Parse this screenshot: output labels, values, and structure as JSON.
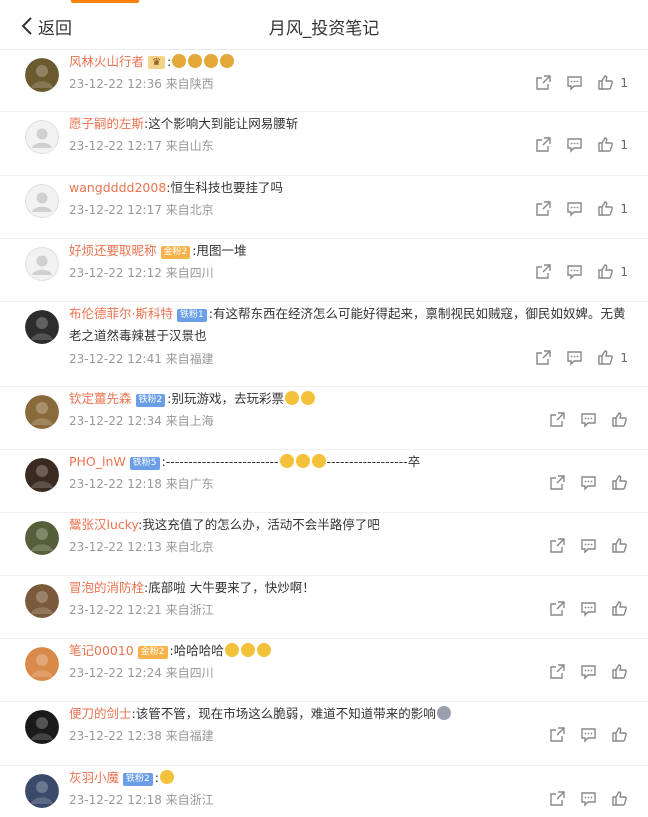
{
  "header": {
    "back_label": "返回",
    "title": "月风_投资笔记"
  },
  "comments": [
    {
      "user": "风林火山行者",
      "badge": "♛",
      "badge_type": "crown",
      "text": "",
      "emojis": [
        "#e2a83a",
        "#e2a83a",
        "#e2a83a",
        "#e2a83a"
      ],
      "meta": "23-12-22 12:36 来自陕西",
      "likes": "1",
      "avatar_color": "#6b5a30"
    },
    {
      "user": "愿子嗣的左斯",
      "badge": "",
      "badge_type": "",
      "text": "这个影响大到能让网易腰斩",
      "emojis": [],
      "meta": "23-12-22 12:17 来自山东",
      "likes": "1",
      "avatar_color": "#d8d8d8"
    },
    {
      "user": "wangdddd2008",
      "badge": "",
      "badge_type": "",
      "text": "恒生科技也要挂了吗",
      "emojis": [],
      "meta": "23-12-22 12:17 来自北京",
      "likes": "1",
      "avatar_color": "#d8d8d8"
    },
    {
      "user": "好烦还要取昵称",
      "badge": "金粉2",
      "badge_type": "gold",
      "text": "甩图一堆",
      "emojis": [],
      "meta": "23-12-22 12:12 来自四川",
      "likes": "1",
      "avatar_color": "#d8d8d8"
    },
    {
      "user": "布伦德菲尔·斯科特",
      "badge": "铁粉1",
      "badge_type": "blue",
      "text": "有这帮东西在经济怎么可能好得起来，禀制视民如贼寇，御民如奴婢。无黄老之道然毒辣甚于汉景也",
      "emojis": [],
      "meta": "23-12-22 12:41 来自福建",
      "likes": "1",
      "avatar_color": "#2d2d2d"
    },
    {
      "user": "钦定薑先森",
      "badge": "铁粉2",
      "badge_type": "blue",
      "text": "别玩游戏，去玩彩票",
      "emojis": [
        "#f3c23a",
        "#f3c23a"
      ],
      "meta": "23-12-22 12:34 来自上海",
      "likes": "",
      "avatar_color": "#8a6a3a"
    },
    {
      "user": "PHO_lnW",
      "badge": "铁粉5",
      "badge_type": "blue",
      "text": "-------------------------",
      "emojis": [
        "#f3c23a",
        "#f3c23a",
        "#f3c23a"
      ],
      "text_after": "------------------卒",
      "meta": "23-12-22 12:18 来自广东",
      "likes": "",
      "avatar_color": "#3a2a20"
    },
    {
      "user": "鬶张汉lucky",
      "badge": "",
      "badge_type": "",
      "text": "我这充值了的怎么办，活动不会半路停了吧",
      "emojis": [],
      "meta": "23-12-22 12:13 来自北京",
      "likes": "",
      "avatar_color": "#55603a"
    },
    {
      "user": "冒泡的消防栓",
      "badge": "",
      "badge_type": "",
      "text": "底部啦 大牛要来了，快炒啊！",
      "emojis": [],
      "meta": "23-12-22 12:21 来自浙江",
      "likes": "",
      "avatar_color": "#7a5a3a"
    },
    {
      "user": "笔记00010",
      "badge": "金粉2",
      "badge_type": "gold",
      "text": "哈哈哈哈",
      "emojis": [
        "#f3c23a",
        "#f3c23a",
        "#f3c23a"
      ],
      "meta": "23-12-22 12:24 来自四川",
      "likes": "",
      "avatar_color": "#d98a4a"
    },
    {
      "user": "便刀的剑士",
      "badge": "",
      "badge_type": "",
      "text": "该管不管，现在市场这么脆弱，难道不知道带来的影响",
      "emojis": [
        "#9aa0b0"
      ],
      "meta": "23-12-22 12:38 来自福建",
      "likes": "",
      "avatar_color": "#1a1a1a"
    },
    {
      "user": "灰羽小魔",
      "badge": "铁粉2",
      "badge_type": "blue",
      "text": "",
      "emojis": [
        "#f3c23a"
      ],
      "meta": "23-12-22 12:18 来自浙江",
      "likes": "",
      "avatar_color": "#3a4a6a"
    }
  ]
}
